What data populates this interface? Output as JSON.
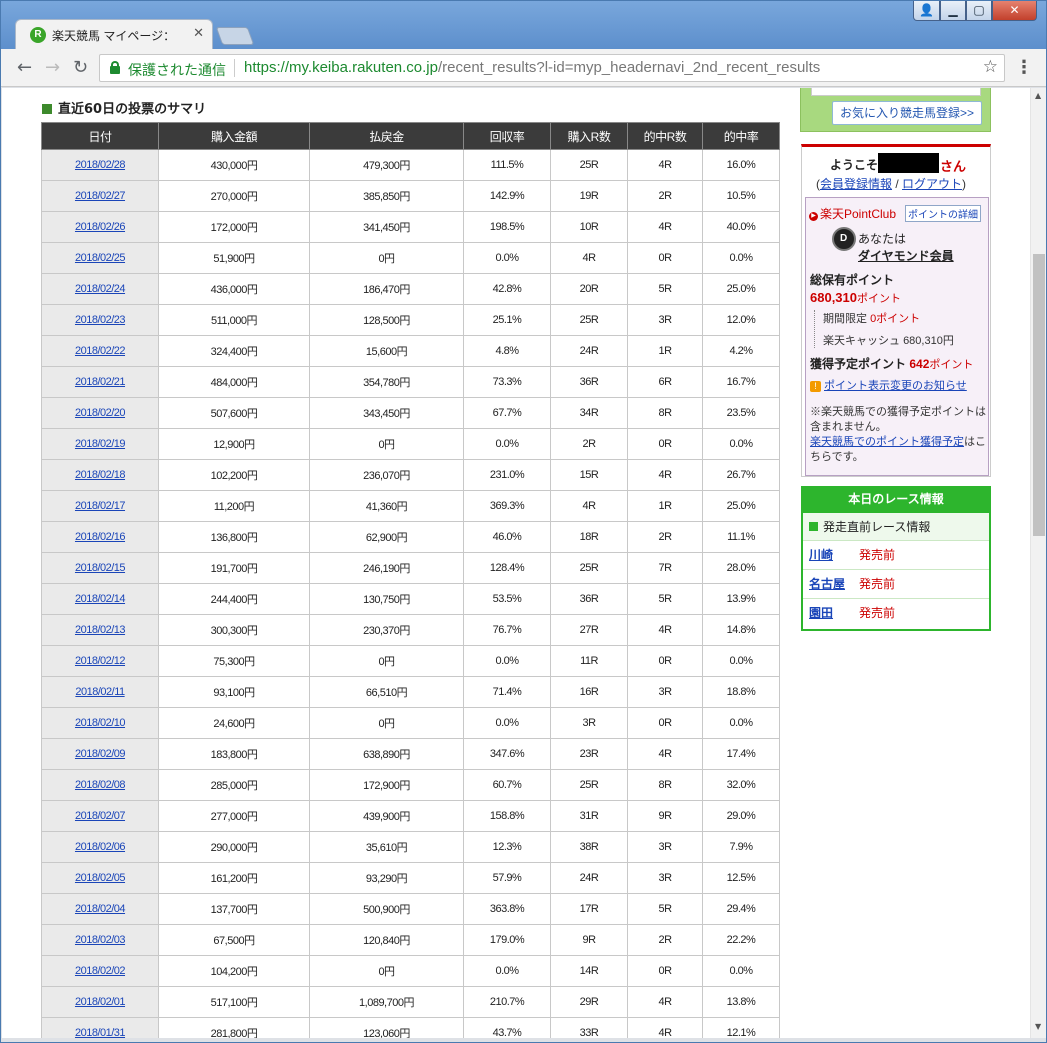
{
  "browser": {
    "tab_title": "楽天競馬 マイページ：",
    "favicon_letter": "R",
    "secure_label": "保護された通信",
    "url_host": "https://my.keiba.rakuten.co.jp",
    "url_path": "/recent_results?l-id=myp_headernavi_2nd_recent_results"
  },
  "summary": {
    "title": "直近60日の投票のサマリ",
    "headers": [
      "日付",
      "購入金額",
      "払戻金",
      "回収率",
      "購入R数",
      "的中R数",
      "的中率"
    ],
    "rows": [
      [
        "2018/02/28",
        "430,000円",
        "479,300円",
        "111.5%",
        "25R",
        "4R",
        "16.0%"
      ],
      [
        "2018/02/27",
        "270,000円",
        "385,850円",
        "142.9%",
        "19R",
        "2R",
        "10.5%"
      ],
      [
        "2018/02/26",
        "172,000円",
        "341,450円",
        "198.5%",
        "10R",
        "4R",
        "40.0%"
      ],
      [
        "2018/02/25",
        "51,900円",
        "0円",
        "0.0%",
        "4R",
        "0R",
        "0.0%"
      ],
      [
        "2018/02/24",
        "436,000円",
        "186,470円",
        "42.8%",
        "20R",
        "5R",
        "25.0%"
      ],
      [
        "2018/02/23",
        "511,000円",
        "128,500円",
        "25.1%",
        "25R",
        "3R",
        "12.0%"
      ],
      [
        "2018/02/22",
        "324,400円",
        "15,600円",
        "4.8%",
        "24R",
        "1R",
        "4.2%"
      ],
      [
        "2018/02/21",
        "484,000円",
        "354,780円",
        "73.3%",
        "36R",
        "6R",
        "16.7%"
      ],
      [
        "2018/02/20",
        "507,600円",
        "343,450円",
        "67.7%",
        "34R",
        "8R",
        "23.5%"
      ],
      [
        "2018/02/19",
        "12,900円",
        "0円",
        "0.0%",
        "2R",
        "0R",
        "0.0%"
      ],
      [
        "2018/02/18",
        "102,200円",
        "236,070円",
        "231.0%",
        "15R",
        "4R",
        "26.7%"
      ],
      [
        "2018/02/17",
        "11,200円",
        "41,360円",
        "369.3%",
        "4R",
        "1R",
        "25.0%"
      ],
      [
        "2018/02/16",
        "136,800円",
        "62,900円",
        "46.0%",
        "18R",
        "2R",
        "11.1%"
      ],
      [
        "2018/02/15",
        "191,700円",
        "246,190円",
        "128.4%",
        "25R",
        "7R",
        "28.0%"
      ],
      [
        "2018/02/14",
        "244,400円",
        "130,750円",
        "53.5%",
        "36R",
        "5R",
        "13.9%"
      ],
      [
        "2018/02/13",
        "300,300円",
        "230,370円",
        "76.7%",
        "27R",
        "4R",
        "14.8%"
      ],
      [
        "2018/02/12",
        "75,300円",
        "0円",
        "0.0%",
        "11R",
        "0R",
        "0.0%"
      ],
      [
        "2018/02/11",
        "93,100円",
        "66,510円",
        "71.4%",
        "16R",
        "3R",
        "18.8%"
      ],
      [
        "2018/02/10",
        "24,600円",
        "0円",
        "0.0%",
        "3R",
        "0R",
        "0.0%"
      ],
      [
        "2018/02/09",
        "183,800円",
        "638,890円",
        "347.6%",
        "23R",
        "4R",
        "17.4%"
      ],
      [
        "2018/02/08",
        "285,000円",
        "172,900円",
        "60.7%",
        "25R",
        "8R",
        "32.0%"
      ],
      [
        "2018/02/07",
        "277,000円",
        "439,900円",
        "158.8%",
        "31R",
        "9R",
        "29.0%"
      ],
      [
        "2018/02/06",
        "290,000円",
        "35,610円",
        "12.3%",
        "38R",
        "3R",
        "7.9%"
      ],
      [
        "2018/02/05",
        "161,200円",
        "93,290円",
        "57.9%",
        "24R",
        "3R",
        "12.5%"
      ],
      [
        "2018/02/04",
        "137,700円",
        "500,900円",
        "363.8%",
        "17R",
        "5R",
        "29.4%"
      ],
      [
        "2018/02/03",
        "67,500円",
        "120,840円",
        "179.0%",
        "9R",
        "2R",
        "22.2%"
      ],
      [
        "2018/02/02",
        "104,200円",
        "0円",
        "0.0%",
        "14R",
        "0R",
        "0.0%"
      ],
      [
        "2018/02/01",
        "517,100円",
        "1,089,700円",
        "210.7%",
        "29R",
        "4R",
        "13.8%"
      ],
      [
        "2018/01/31",
        "281,800円",
        "123,060円",
        "43.7%",
        "33R",
        "4R",
        "12.1%"
      ]
    ]
  },
  "sidebar": {
    "fav_button": "お気に入り競走馬登録>>",
    "welcome_prefix": "ようこそ",
    "welcome_suffix": "さん",
    "member_info": "会員登録情報",
    "logout": "ログアウト",
    "pointclub_logo": "楽天PointClub",
    "pointclub_detail": "ポイントの詳細",
    "you_are": "あなたは",
    "rank": "ダイヤモンド会員",
    "total_label": "総保有ポイント",
    "total_points": "680,310",
    "points_unit": "ポイント",
    "limited_label": "期間限定",
    "limited_value": "0ポイント",
    "cash_label": "楽天キャッシュ",
    "cash_value": "680,310円",
    "expected_label": "獲得予定ポイント",
    "expected_value": "642",
    "notice_link": "ポイント表示変更のお知らせ",
    "note_text": "※楽天競馬での獲得予定ポイントは含まれません。",
    "note_link": "楽天競馬でのポイント獲得予定",
    "note_tail": "はこちらです。"
  },
  "races": {
    "header": "本日のレース情報",
    "subheader": "発走直前レース情報",
    "items": [
      {
        "venue": "川崎",
        "status": "発売前"
      },
      {
        "venue": "名古屋",
        "status": "発売前"
      },
      {
        "venue": "園田",
        "status": "発売前"
      }
    ]
  }
}
